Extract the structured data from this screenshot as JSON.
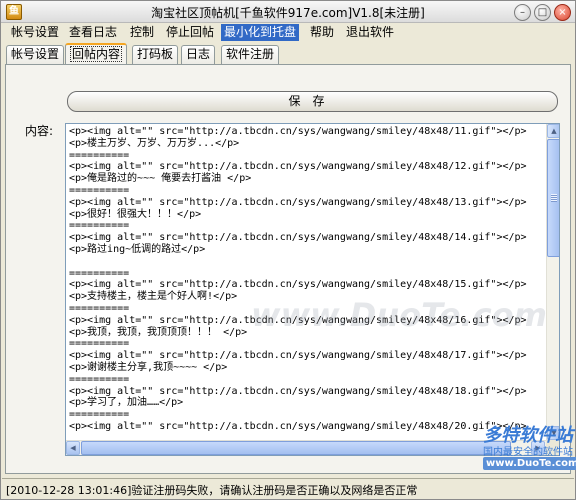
{
  "window": {
    "title": "淘宝社区顶帖机[千鱼软件917e.com]V1.8[未注册]",
    "minimize_label": "–",
    "maximize_label": "□",
    "close_label": "×"
  },
  "menu": {
    "items": [
      "帐号设置",
      "查看日志",
      "控制",
      "停止回帖",
      "最小化到托盘",
      "帮助",
      "退出软件"
    ],
    "active": "最小化到托盘"
  },
  "tabs": {
    "items": [
      "帐号设置",
      "回帖内容",
      "打码板",
      "日志",
      "软件注册"
    ],
    "selected": "回帖内容"
  },
  "panel": {
    "save_label": "保存",
    "content_label": "内容:",
    "lines": [
      "<p><img alt=\"\" src=\"http://a.tbcdn.cn/sys/wangwang/smiley/48x48/11.gif\"></p>",
      "<p>楼主万岁、万岁、万万岁...</p>",
      "==========",
      "<p><img alt=\"\" src=\"http://a.tbcdn.cn/sys/wangwang/smiley/48x48/12.gif\"></p>",
      "<p>俺是路过的~~~ 俺要去打酱油 </p>",
      "==========",
      "<p><img alt=\"\" src=\"http://a.tbcdn.cn/sys/wangwang/smiley/48x48/13.gif\"></p>",
      "<p>很好！很强大！！！</p>",
      "==========",
      "<p><img alt=\"\" src=\"http://a.tbcdn.cn/sys/wangwang/smiley/48x48/14.gif\"></p>",
      "<p>路过ing~低调的路过</p>",
      "",
      "==========",
      "<p><img alt=\"\" src=\"http://a.tbcdn.cn/sys/wangwang/smiley/48x48/15.gif\"></p>",
      "<p>支持楼主，楼主是个好人啊!</p>",
      "==========",
      "<p><img alt=\"\" src=\"http://a.tbcdn.cn/sys/wangwang/smiley/48x48/16.gif\"></p>",
      "<p>我顶，我顶，我顶顶顶！！！ </p>",
      "==========",
      "<p><img alt=\"\" src=\"http://a.tbcdn.cn/sys/wangwang/smiley/48x48/17.gif\"></p>",
      "<p>谢谢楼主分享,我顶~~~~ </p>",
      "==========",
      "<p><img alt=\"\" src=\"http://a.tbcdn.cn/sys/wangwang/smiley/48x48/18.gif\"></p>",
      "<p>学习了，加油……</p>",
      "==========",
      "<p><img alt=\"\" src=\"http://a.tbcdn.cn/sys/wangwang/smiley/48x48/20.gif\"></p>"
    ]
  },
  "status": {
    "text": "[2010-12-28 13:01:46]验证注册码失败，请确认注册码是否正确以及网络是否正常"
  },
  "watermarks": {
    "center": "www.DuoTe.com",
    "badge_logo": "多特软件站",
    "badge_sub": "国内最安全的软件站",
    "badge_site": "www.DuoTe.com"
  },
  "icons": {
    "app": "app-icon",
    "scroll_up": "arrow-up-icon",
    "scroll_down": "arrow-down-icon",
    "scroll_left": "arrow-left-icon",
    "scroll_right": "arrow-right-icon"
  },
  "colors": {
    "menu_active_bg": "#3169c6",
    "tab_selected_accent": "#f5a623",
    "scroll_thumb": "#a3bff0"
  }
}
